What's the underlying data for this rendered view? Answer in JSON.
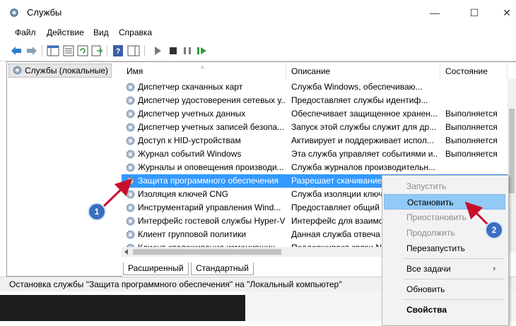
{
  "window": {
    "title": "Службы",
    "minimize": "—",
    "maximize": "☐",
    "close": "✕"
  },
  "menu": [
    "Файл",
    "Действие",
    "Вид",
    "Справка"
  ],
  "tree": {
    "root": "Службы (локальные)"
  },
  "columns": {
    "name": "Имя",
    "description": "Описание",
    "status": "Состояние"
  },
  "rows": [
    {
      "name": "Диспетчер скачанных карт",
      "desc": "Служба Windows, обеспечиваю...",
      "status": ""
    },
    {
      "name": "Диспетчер удостоверения сетевых у...",
      "desc": "Предоставляет службы идентиф...",
      "status": ""
    },
    {
      "name": "Диспетчер учетных данных",
      "desc": "Обеспечивает защищенное хранен...",
      "status": "Выполняется"
    },
    {
      "name": "Диспетчер учетных записей безопа...",
      "desc": "Запуск этой службы служит для др...",
      "status": "Выполняется"
    },
    {
      "name": "Доступ к HID-устройствам",
      "desc": "Активирует и поддерживает испол...",
      "status": "Выполняется"
    },
    {
      "name": "Журнал событий Windows",
      "desc": "Эта служба управляет событиями и...",
      "status": "Выполняется"
    },
    {
      "name": "Журналы и оповещения производи...",
      "desc": "Служба журналов производительн...",
      "status": ""
    },
    {
      "name": "Защита программного обеспечения",
      "desc": "Разрешает скачивание,",
      "status": ""
    },
    {
      "name": "Изоляция ключей CNG",
      "desc": "Служба изоляции ключей",
      "status": ""
    },
    {
      "name": "Инструментарий управления Wind...",
      "desc": "Предоставляет общий",
      "status": ""
    },
    {
      "name": "Интерфейс гостевой службы Hyper-V",
      "desc": "Интерфейс для взаимо",
      "status": ""
    },
    {
      "name": "Клиент групповой политики",
      "desc": "Данная служба отвеча",
      "status": ""
    },
    {
      "name": "Клиент отслеживания изменивших...",
      "desc": "Поддерживает связи N",
      "status": ""
    }
  ],
  "tabs": [
    "Расширенный",
    "Стандартный"
  ],
  "status_text": "Остановка службы \"Защита программного обеспечения\" на \"Локальный компьютер\"",
  "context_menu": {
    "start": "Запустить",
    "stop": "Остановить",
    "pause": "Приостановить",
    "resume": "Продолжить",
    "restart": "Перезапустить",
    "all_tasks": "Все задачи",
    "all_tasks_arrow": "›",
    "refresh": "Обновить",
    "properties": "Свойства"
  },
  "badges": {
    "one": "1",
    "two": "2"
  },
  "colors": {
    "selection": "#3399ff",
    "highlight": "#91c9f7",
    "badge": "#3a6fbf",
    "arrow": "#c8102e"
  }
}
